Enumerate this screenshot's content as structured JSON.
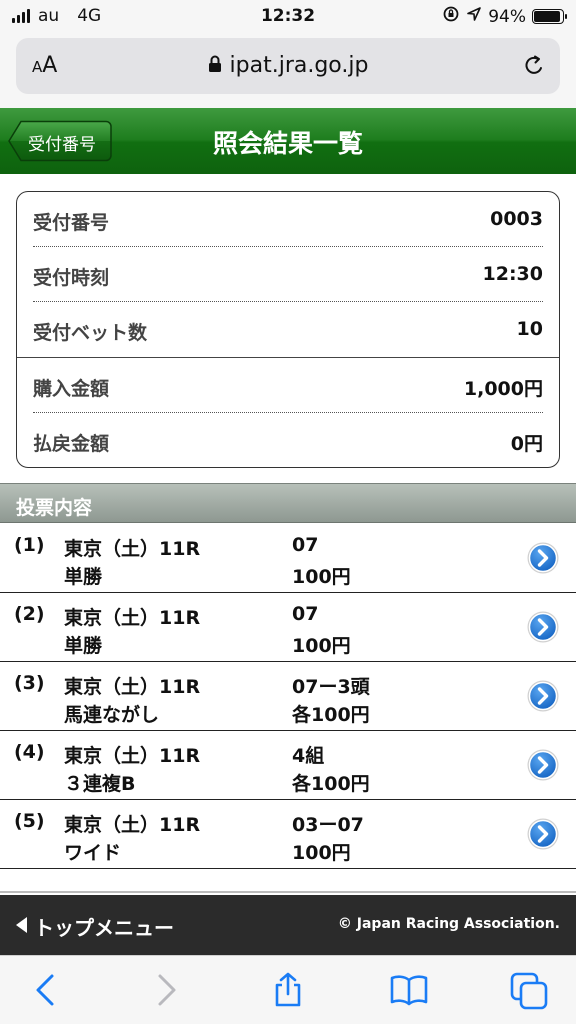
{
  "status_bar": {
    "carrier": "au",
    "network": "4G",
    "time": "12:32",
    "battery": "94%",
    "battery_level": 0.94
  },
  "browser": {
    "text_size_label": "AA",
    "url": "ipat.jra.go.jp"
  },
  "header": {
    "back_label": "受付番号",
    "title": "照会結果一覧"
  },
  "summary": {
    "rows": [
      {
        "label": "受付番号",
        "value": "0003"
      },
      {
        "label": "受付時刻",
        "value": "12:30"
      },
      {
        "label": "受付ベット数",
        "value": "10"
      },
      {
        "label": "購入金額",
        "value": "1,000円"
      },
      {
        "label": "払戻金額",
        "value": "0円"
      }
    ]
  },
  "section": {
    "title": "投票内容"
  },
  "bets": [
    {
      "num": "(1)",
      "race": "東京（土）11R",
      "type": "単勝",
      "combo": "07",
      "amount": "100円"
    },
    {
      "num": "(2)",
      "race": "東京（土）11R",
      "type": "単勝",
      "combo": "07",
      "amount": "100円"
    },
    {
      "num": "(3)",
      "race": "東京（土）11R",
      "type": "馬連ながし",
      "combo": "07ー3頭",
      "amount": "各100円"
    },
    {
      "num": "(4)",
      "race": "東京（土）11R",
      "type": "３連複B",
      "combo": "4組",
      "amount": "各100円"
    },
    {
      "num": "(5)",
      "race": "東京（土）11R",
      "type": "ワイド",
      "combo": "03ー07",
      "amount": "100円"
    }
  ],
  "footer": {
    "top_menu": "トップメニュー",
    "copyright": "© Japan Racing Association."
  },
  "colors": {
    "header_green": "#1e7d1e",
    "chevron_blue": "#1a6fd0",
    "footer_bg": "#2b2b2b",
    "ios_blue": "#1a7cf5"
  }
}
